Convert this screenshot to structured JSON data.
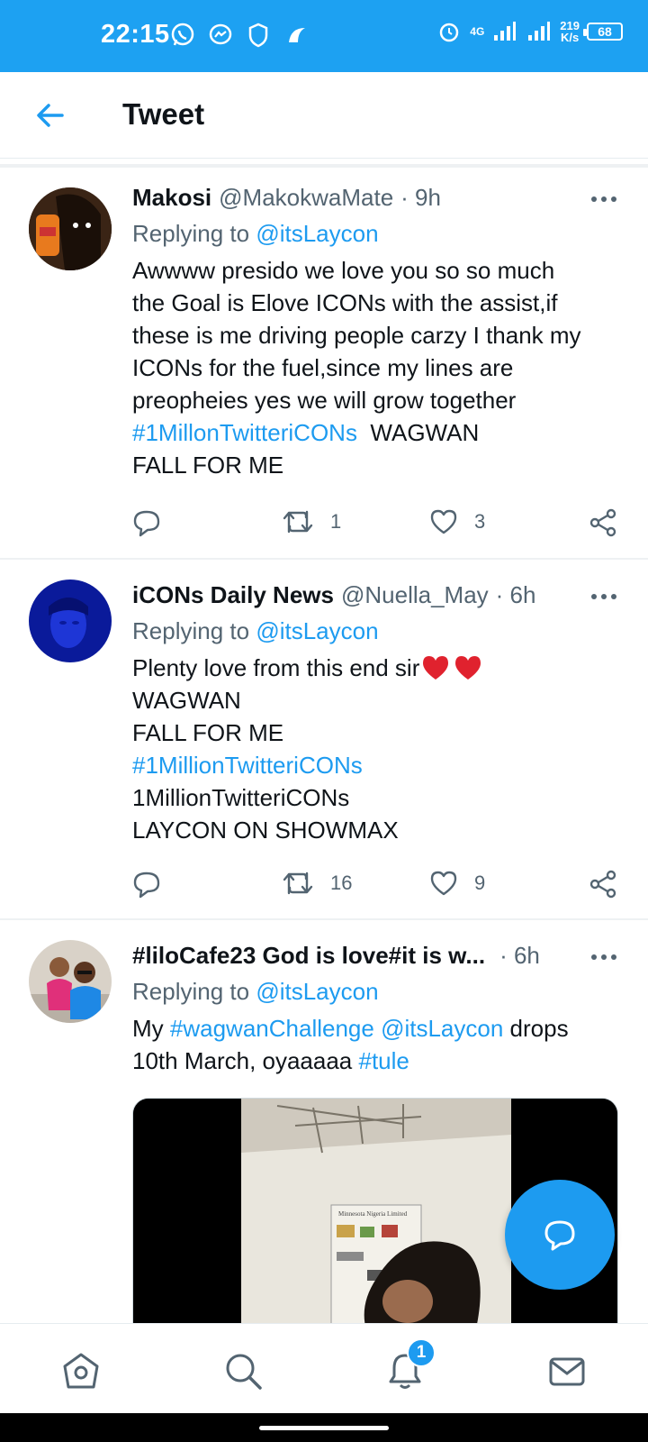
{
  "status_bar": {
    "time": "22:15",
    "network": "4G",
    "speed_value": "219",
    "speed_unit": "K/s",
    "battery": "68"
  },
  "header": {
    "title": "Tweet"
  },
  "tweets": [
    {
      "name": "Makosi",
      "handle": "@MakokwaMate",
      "time": "· 9h",
      "reply_prefix": "Replying to ",
      "reply_to": "@itsLaycon",
      "body_lines": [
        "Awwww presido we love you so so much",
        "the Goal is Elove ICONs with the assist,if",
        "these is me driving people carzy I thank my",
        "ICONs for the fuel,since my lines are",
        "preopheies yes we will grow together"
      ],
      "hashtag": "#1MillonTwitteriCONs",
      "hashtag_after": "  WAGWAN",
      "last_line": "FALL FOR ME",
      "retweets": "1",
      "likes": "3"
    },
    {
      "name": "iCONs Daily News",
      "handle": "@Nuella_May",
      "time": "· 6h",
      "reply_prefix": "Replying to ",
      "reply_to": "@itsLaycon",
      "line1": "Plenty love from this end sir",
      "line2": "WAGWAN",
      "line3": "FALL FOR ME",
      "hashtag": "#1MillionTwitteriCONs",
      "line5": "1MillionTwitteriCONs",
      "line6": "LAYCON ON SHOWMAX",
      "retweets": "16",
      "likes": "9"
    },
    {
      "name": "#liloCafe23 God is love#it is w...",
      "time": "· 6h",
      "reply_prefix": "Replying to ",
      "reply_to": "@itsLaycon",
      "body_my": "My ",
      "hashtag1": "#wagwanChallenge",
      "mention": "@itsLaycon",
      "body_drops": " drops",
      "body_line2": "10th March, oyaaaaa ",
      "hashtag2": "#tule",
      "media_poster_text": "Minnesota Nigeria Limited"
    }
  ],
  "bottom_nav": {
    "notification_count": "1"
  },
  "colors": {
    "accent": "#1d9bf0",
    "status_bar": "#1da1f2",
    "text_secondary": "#536471"
  }
}
